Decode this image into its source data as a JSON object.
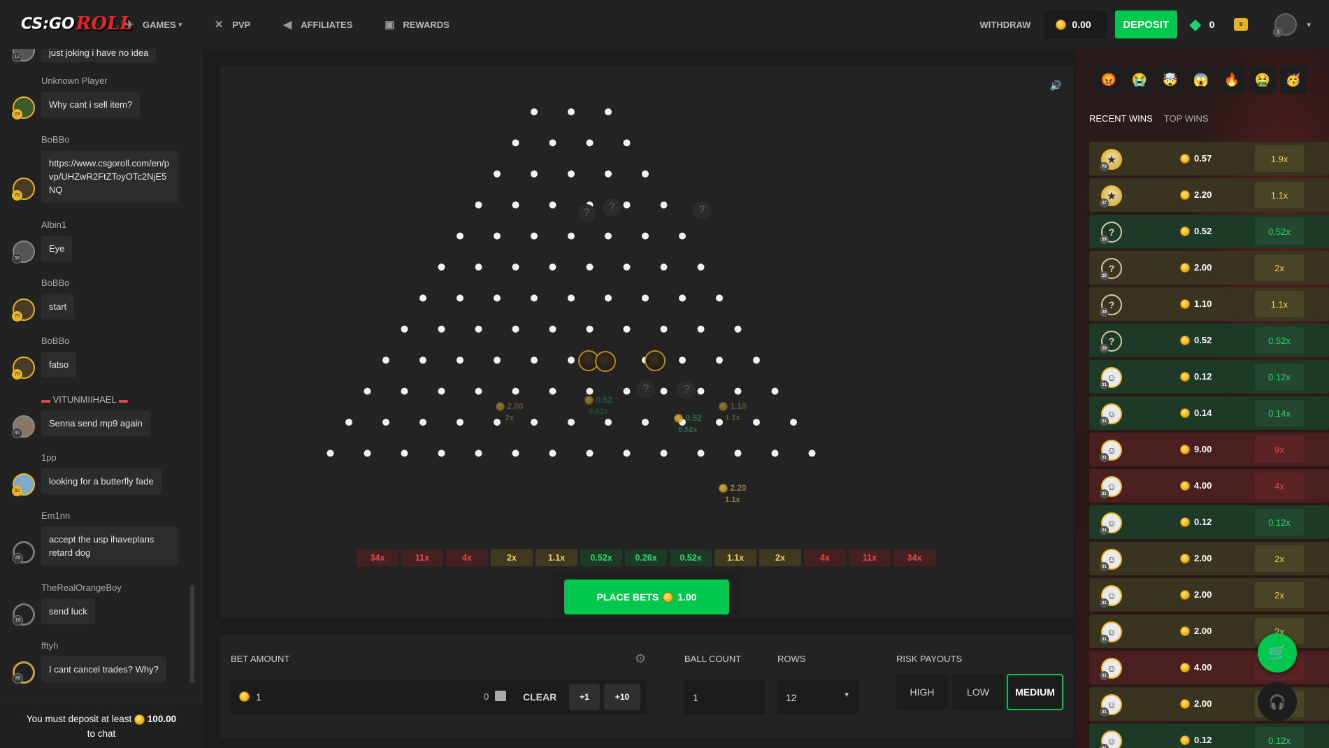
{
  "header": {
    "logo_cs": "CS:GO",
    "logo_roll": "ROLL",
    "nav": [
      {
        "label": "GAMES",
        "icon": "games-icon"
      },
      {
        "label": "PVP",
        "icon": "swords-icon"
      },
      {
        "label": "AFFILIATES",
        "icon": "megaphone-icon"
      },
      {
        "label": "REWARDS",
        "icon": "gift-icon"
      }
    ],
    "withdraw": "WITHDRAW",
    "balance": "0.00",
    "deposit": "DEPOSIT",
    "gems": "0",
    "user_level": "1"
  },
  "chat": {
    "messages": [
      {
        "user": "",
        "text": "just joking i have no idea",
        "level": "12"
      },
      {
        "user": "Unknown Player",
        "text": "Why cant i sell item?",
        "level": "23"
      },
      {
        "user": "BoBBo",
        "text": "https://www.csgoroll.com/en/pvp/UHZwR2FtZToyOTc2NjE5NQ",
        "level": "70"
      },
      {
        "user": "Albin1",
        "text": "Eye",
        "level": "55"
      },
      {
        "user": "BoBBo",
        "text": "start",
        "level": "70"
      },
      {
        "user": "BoBBo",
        "text": "fatso",
        "level": "70"
      },
      {
        "user": "VITUNMIIHAEL",
        "text": "Senna send mp9 again",
        "level": "42"
      },
      {
        "user": "1pp",
        "text": "looking for a butterfly fade",
        "level": "60"
      },
      {
        "user": "Em1nn",
        "text": "accept the usp ihaveplans retard dog",
        "level": "45"
      },
      {
        "user": "TheRealOrangeBoy",
        "text": "send luck",
        "level": "18"
      },
      {
        "user": "fftyh",
        "text": "I cant cancel trades? Why?",
        "level": "30"
      }
    ],
    "footer_prefix": "You must deposit at least",
    "footer_amount": "100.00",
    "footer_suffix": "to chat"
  },
  "game": {
    "buckets": [
      {
        "label": "34x",
        "tone": "red"
      },
      {
        "label": "11x",
        "tone": "red"
      },
      {
        "label": "4x",
        "tone": "red"
      },
      {
        "label": "2x",
        "tone": "yel"
      },
      {
        "label": "1.1x",
        "tone": "yel"
      },
      {
        "label": "0.52x",
        "tone": "grn"
      },
      {
        "label": "0.26x",
        "tone": "grn"
      },
      {
        "label": "0.52x",
        "tone": "grn"
      },
      {
        "label": "1.1x",
        "tone": "yel"
      },
      {
        "label": "2x",
        "tone": "yel"
      },
      {
        "label": "4x",
        "tone": "red"
      },
      {
        "label": "11x",
        "tone": "red"
      },
      {
        "label": "34x",
        "tone": "red"
      }
    ],
    "ghosts": [
      {
        "amt": "2.00",
        "mult": "2x"
      },
      {
        "amt": "0.52",
        "mult": "0.52x"
      },
      {
        "amt": "0.52",
        "mult": "0.52x"
      },
      {
        "amt": "1.10",
        "mult": "1.1x"
      },
      {
        "amt": "2.20",
        "mult": "1.1x"
      }
    ],
    "place_bets": "PLACE BETS",
    "place_amount": "1.00"
  },
  "controls": {
    "bet_amount_label": "BET AMOUNT",
    "bet_value": "1",
    "bet_max": "0",
    "clear": "CLEAR",
    "plus1": "+1",
    "plus10": "+10",
    "ball_count_label": "BALL COUNT",
    "ball_count_value": "1",
    "rows_label": "ROWS",
    "rows_value": "12",
    "risk_label": "RISK PAYOUTS",
    "risk_high": "HIGH",
    "risk_low": "LOW",
    "risk_medium": "MEDIUM"
  },
  "wins": {
    "tab_recent": "RECENT WINS",
    "tab_top": "TOP WINS",
    "emojis": [
      "😡",
      "😭",
      "🤯",
      "😱",
      "🔥",
      "🤮",
      "🥳"
    ],
    "rows": [
      {
        "amt": "0.57",
        "mult": "1.9x",
        "tone": "yel",
        "level": "70",
        "kind": "img"
      },
      {
        "amt": "2.20",
        "mult": "1.1x",
        "tone": "yel",
        "level": "27",
        "kind": "img"
      },
      {
        "amt": "0.52",
        "mult": "0.52x",
        "tone": "grn",
        "level": "29",
        "kind": "q"
      },
      {
        "amt": "2.00",
        "mult": "2x",
        "tone": "yel",
        "level": "29",
        "kind": "q"
      },
      {
        "amt": "1.10",
        "mult": "1.1x",
        "tone": "yel",
        "level": "29",
        "kind": "q"
      },
      {
        "amt": "0.52",
        "mult": "0.52x",
        "tone": "grn",
        "level": "29",
        "kind": "q"
      },
      {
        "amt": "0.12",
        "mult": "0.12x",
        "tone": "grn",
        "level": "31",
        "kind": "face"
      },
      {
        "amt": "0.14",
        "mult": "0.14x",
        "tone": "grn",
        "level": "31",
        "kind": "face"
      },
      {
        "amt": "9.00",
        "mult": "9x",
        "tone": "red",
        "level": "31",
        "kind": "face"
      },
      {
        "amt": "4.00",
        "mult": "4x",
        "tone": "red",
        "level": "31",
        "kind": "face"
      },
      {
        "amt": "0.12",
        "mult": "0.12x",
        "tone": "grn",
        "level": "31",
        "kind": "face"
      },
      {
        "amt": "2.00",
        "mult": "2x",
        "tone": "yel",
        "level": "31",
        "kind": "face"
      },
      {
        "amt": "2.00",
        "mult": "2x",
        "tone": "yel",
        "level": "31",
        "kind": "face"
      },
      {
        "amt": "2.00",
        "mult": "2x",
        "tone": "yel",
        "level": "31",
        "kind": "face"
      },
      {
        "amt": "4.00",
        "mult": "4x",
        "tone": "red",
        "level": "31",
        "kind": "face"
      },
      {
        "amt": "2.00",
        "mult": "2x",
        "tone": "yel",
        "level": "31",
        "kind": "face"
      },
      {
        "amt": "0.12",
        "mult": "0.12x",
        "tone": "grn",
        "level": "31",
        "kind": "face"
      }
    ]
  }
}
